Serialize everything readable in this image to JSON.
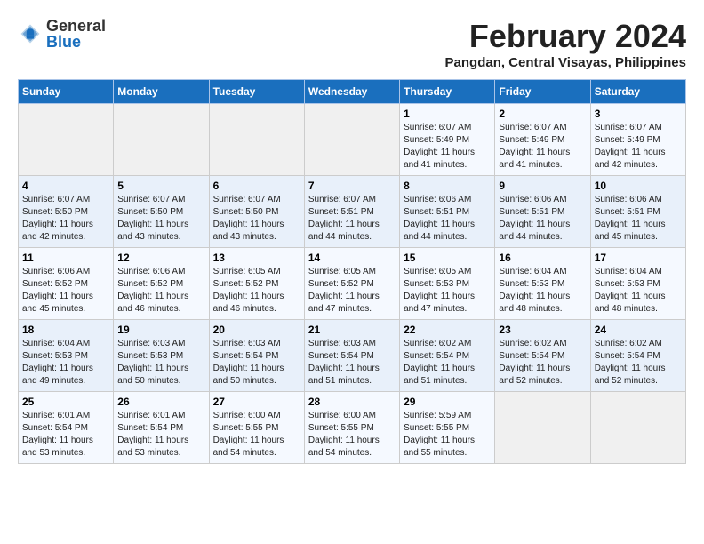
{
  "header": {
    "logo_general": "General",
    "logo_blue": "Blue",
    "month_title": "February 2024",
    "location": "Pangdan, Central Visayas, Philippines"
  },
  "days_of_week": [
    "Sunday",
    "Monday",
    "Tuesday",
    "Wednesday",
    "Thursday",
    "Friday",
    "Saturday"
  ],
  "weeks": [
    [
      {
        "day": "",
        "info": ""
      },
      {
        "day": "",
        "info": ""
      },
      {
        "day": "",
        "info": ""
      },
      {
        "day": "",
        "info": ""
      },
      {
        "day": "1",
        "info": "Sunrise: 6:07 AM\nSunset: 5:49 PM\nDaylight: 11 hours\nand 41 minutes."
      },
      {
        "day": "2",
        "info": "Sunrise: 6:07 AM\nSunset: 5:49 PM\nDaylight: 11 hours\nand 41 minutes."
      },
      {
        "day": "3",
        "info": "Sunrise: 6:07 AM\nSunset: 5:49 PM\nDaylight: 11 hours\nand 42 minutes."
      }
    ],
    [
      {
        "day": "4",
        "info": "Sunrise: 6:07 AM\nSunset: 5:50 PM\nDaylight: 11 hours\nand 42 minutes."
      },
      {
        "day": "5",
        "info": "Sunrise: 6:07 AM\nSunset: 5:50 PM\nDaylight: 11 hours\nand 43 minutes."
      },
      {
        "day": "6",
        "info": "Sunrise: 6:07 AM\nSunset: 5:50 PM\nDaylight: 11 hours\nand 43 minutes."
      },
      {
        "day": "7",
        "info": "Sunrise: 6:07 AM\nSunset: 5:51 PM\nDaylight: 11 hours\nand 44 minutes."
      },
      {
        "day": "8",
        "info": "Sunrise: 6:06 AM\nSunset: 5:51 PM\nDaylight: 11 hours\nand 44 minutes."
      },
      {
        "day": "9",
        "info": "Sunrise: 6:06 AM\nSunset: 5:51 PM\nDaylight: 11 hours\nand 44 minutes."
      },
      {
        "day": "10",
        "info": "Sunrise: 6:06 AM\nSunset: 5:51 PM\nDaylight: 11 hours\nand 45 minutes."
      }
    ],
    [
      {
        "day": "11",
        "info": "Sunrise: 6:06 AM\nSunset: 5:52 PM\nDaylight: 11 hours\nand 45 minutes."
      },
      {
        "day": "12",
        "info": "Sunrise: 6:06 AM\nSunset: 5:52 PM\nDaylight: 11 hours\nand 46 minutes."
      },
      {
        "day": "13",
        "info": "Sunrise: 6:05 AM\nSunset: 5:52 PM\nDaylight: 11 hours\nand 46 minutes."
      },
      {
        "day": "14",
        "info": "Sunrise: 6:05 AM\nSunset: 5:52 PM\nDaylight: 11 hours\nand 47 minutes."
      },
      {
        "day": "15",
        "info": "Sunrise: 6:05 AM\nSunset: 5:53 PM\nDaylight: 11 hours\nand 47 minutes."
      },
      {
        "day": "16",
        "info": "Sunrise: 6:04 AM\nSunset: 5:53 PM\nDaylight: 11 hours\nand 48 minutes."
      },
      {
        "day": "17",
        "info": "Sunrise: 6:04 AM\nSunset: 5:53 PM\nDaylight: 11 hours\nand 48 minutes."
      }
    ],
    [
      {
        "day": "18",
        "info": "Sunrise: 6:04 AM\nSunset: 5:53 PM\nDaylight: 11 hours\nand 49 minutes."
      },
      {
        "day": "19",
        "info": "Sunrise: 6:03 AM\nSunset: 5:53 PM\nDaylight: 11 hours\nand 50 minutes."
      },
      {
        "day": "20",
        "info": "Sunrise: 6:03 AM\nSunset: 5:54 PM\nDaylight: 11 hours\nand 50 minutes."
      },
      {
        "day": "21",
        "info": "Sunrise: 6:03 AM\nSunset: 5:54 PM\nDaylight: 11 hours\nand 51 minutes."
      },
      {
        "day": "22",
        "info": "Sunrise: 6:02 AM\nSunset: 5:54 PM\nDaylight: 11 hours\nand 51 minutes."
      },
      {
        "day": "23",
        "info": "Sunrise: 6:02 AM\nSunset: 5:54 PM\nDaylight: 11 hours\nand 52 minutes."
      },
      {
        "day": "24",
        "info": "Sunrise: 6:02 AM\nSunset: 5:54 PM\nDaylight: 11 hours\nand 52 minutes."
      }
    ],
    [
      {
        "day": "25",
        "info": "Sunrise: 6:01 AM\nSunset: 5:54 PM\nDaylight: 11 hours\nand 53 minutes."
      },
      {
        "day": "26",
        "info": "Sunrise: 6:01 AM\nSunset: 5:54 PM\nDaylight: 11 hours\nand 53 minutes."
      },
      {
        "day": "27",
        "info": "Sunrise: 6:00 AM\nSunset: 5:55 PM\nDaylight: 11 hours\nand 54 minutes."
      },
      {
        "day": "28",
        "info": "Sunrise: 6:00 AM\nSunset: 5:55 PM\nDaylight: 11 hours\nand 54 minutes."
      },
      {
        "day": "29",
        "info": "Sunrise: 5:59 AM\nSunset: 5:55 PM\nDaylight: 11 hours\nand 55 minutes."
      },
      {
        "day": "",
        "info": ""
      },
      {
        "day": "",
        "info": ""
      }
    ]
  ]
}
